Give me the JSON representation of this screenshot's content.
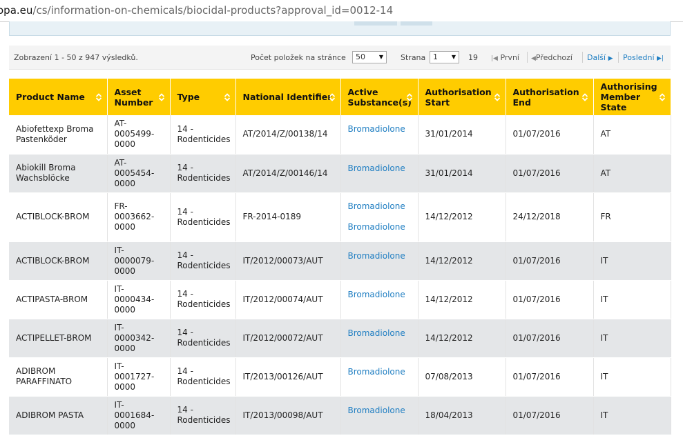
{
  "browser": {
    "url_host": "opa.eu",
    "url_path": "/cs/information-on-chemicals/biocidal-products?approval_id=0012-14"
  },
  "pager": {
    "info": "Zobrazení 1 - 50 z 947 výsledků.",
    "per_page_label": "Počet položek na stránce",
    "per_page_value": "50",
    "page_label": "Strana",
    "page_value": "1",
    "total_pages": "19",
    "first": "První",
    "prev": "Předchozí",
    "next": "Další",
    "last": "Poslední"
  },
  "table": {
    "headers": [
      "Product Name",
      "Asset Number",
      "Type",
      "National Identifier",
      "Active Substance(s)",
      "Authorisation Start",
      "Authorisation End",
      "Authorising Member State"
    ],
    "rows": [
      {
        "name": "Abiofettexp Broma Pastenköder",
        "asset": "AT-0005499-0000",
        "type": "14 - Rodenticides",
        "nid": "AT/2014/Z/00138/14",
        "substances": [
          "Bromadiolone"
        ],
        "start": "31/01/2014",
        "end": "01/07/2016",
        "state": "AT"
      },
      {
        "name": "Abiokill Broma Wachsblöcke",
        "asset": "AT-0005454-0000",
        "type": "14 - Rodenticides",
        "nid": "AT/2014/Z/00146/14",
        "substances": [
          "Bromadiolone"
        ],
        "start": "31/01/2014",
        "end": "01/07/2016",
        "state": "AT"
      },
      {
        "name": "ACTIBLOCK-BROM",
        "asset": "FR-0003662-0000",
        "type": "14 - Rodenticides",
        "nid": "FR-2014-0189",
        "substances": [
          "Bromadiolone",
          "Bromadiolone"
        ],
        "start": "14/12/2012",
        "end": "24/12/2018",
        "state": "FR"
      },
      {
        "name": "ACTIBLOCK-BROM",
        "asset": "IT-0000079-0000",
        "type": "14 - Rodenticides",
        "nid": "IT/2012/00073/AUT",
        "substances": [
          "Bromadiolone"
        ],
        "start": "14/12/2012",
        "end": "01/07/2016",
        "state": "IT"
      },
      {
        "name": "ACTIPASTA-BROM",
        "asset": "IT-0000434-0000",
        "type": "14 - Rodenticides",
        "nid": "IT/2012/00074/AUT",
        "substances": [
          "Bromadiolone"
        ],
        "start": "14/12/2012",
        "end": "01/07/2016",
        "state": "IT"
      },
      {
        "name": "ACTIPELLET-BROM",
        "asset": "IT-0000342-0000",
        "type": "14 - Rodenticides",
        "nid": "IT/2012/00072/AUT",
        "substances": [
          "Bromadiolone"
        ],
        "start": "14/12/2012",
        "end": "01/07/2016",
        "state": "IT"
      },
      {
        "name": "ADIBROM PARAFFINATO",
        "asset": "IT-0001727-0000",
        "type": "14 - Rodenticides",
        "nid": "IT/2013/00126/AUT",
        "substances": [
          "Bromadiolone"
        ],
        "start": "07/08/2013",
        "end": "01/07/2016",
        "state": "IT"
      },
      {
        "name": "ADIBROM PASTA",
        "asset": "IT-0001684-0000",
        "type": "14 - Rodenticides",
        "nid": "IT/2013/00098/AUT",
        "substances": [
          "Bromadiolone"
        ],
        "start": "18/04/2013",
        "end": "01/07/2016",
        "state": "IT"
      }
    ]
  },
  "colors": {
    "header_bg": "#ffcc00",
    "link": "#1f7ec2",
    "row_alt": "#e4e6e8"
  }
}
